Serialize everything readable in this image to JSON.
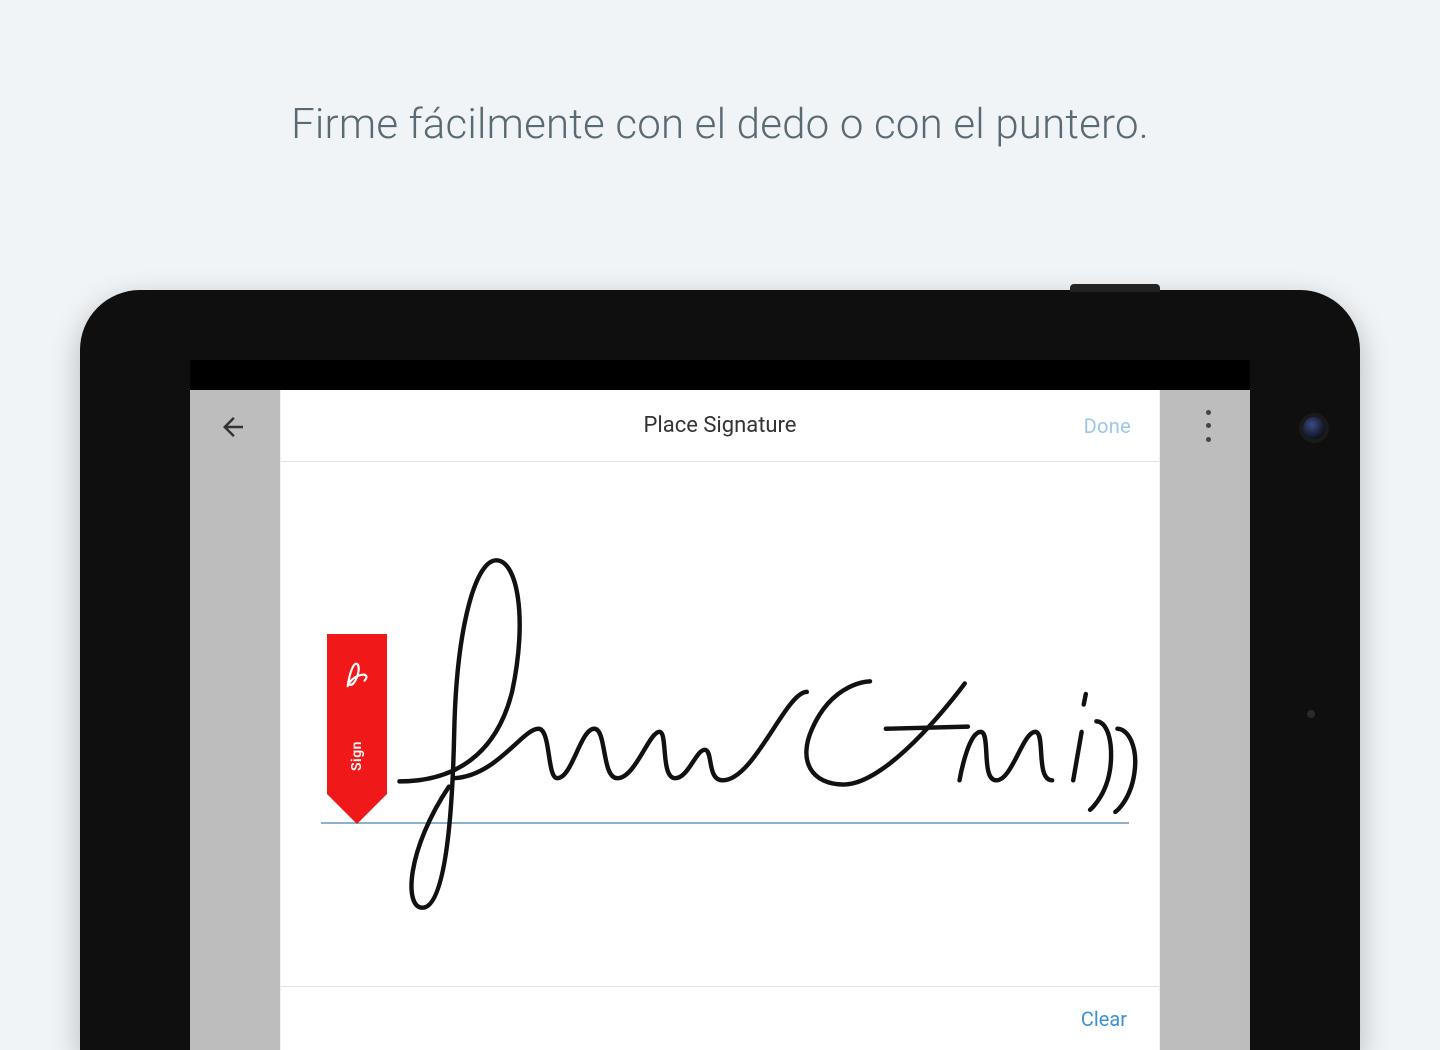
{
  "headline": "Firme fácilmente con el dedo o con el puntero.",
  "modal": {
    "title": "Place Signature",
    "done_label": "Done",
    "clear_label": "Clear",
    "sign_flag_label": "Sign",
    "signature_text": "Jane Smith"
  },
  "colors": {
    "background": "#f0f4f6",
    "accent_red": "#f01818",
    "link_blue": "#3a91d6",
    "done_disabled": "#9dc7ea",
    "baseline": "#8bb2cc"
  }
}
